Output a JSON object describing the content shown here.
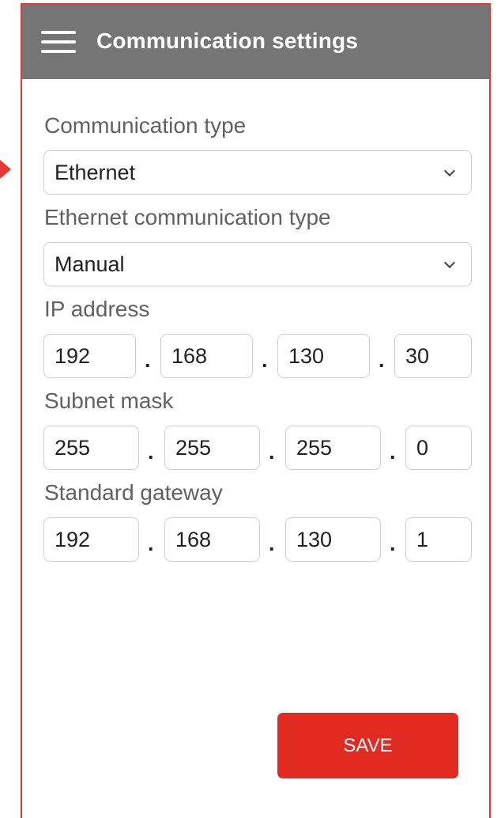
{
  "header": {
    "title": "Communication settings",
    "menu_icon": "hamburger-menu-icon",
    "background_color": "#757575"
  },
  "form": {
    "communication_type": {
      "label": "Communication type",
      "value": "Ethernet"
    },
    "ethernet_type": {
      "label": "Ethernet communication type",
      "value": "Manual"
    },
    "ip_address": {
      "label": "IP address",
      "octets": [
        "192",
        "168",
        "130",
        "30"
      ]
    },
    "subnet_mask": {
      "label": "Subnet mask",
      "octets": [
        "255",
        "255",
        "255",
        "0"
      ]
    },
    "gateway": {
      "label": "Standard gateway",
      "octets": [
        "192",
        "168",
        "130",
        "1"
      ]
    },
    "separator": "."
  },
  "save_button": {
    "label": "SAVE",
    "color": "#e02a22"
  },
  "accent_color": "#e53935"
}
